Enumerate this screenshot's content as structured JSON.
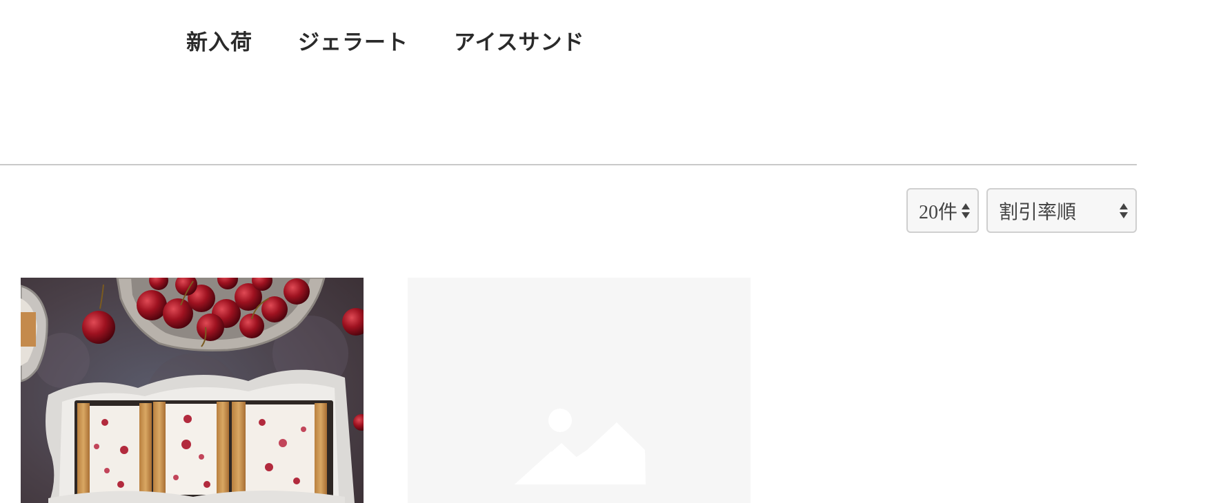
{
  "nav": {
    "items": [
      {
        "label": "新入荷"
      },
      {
        "label": "ジェラート"
      },
      {
        "label": "アイスサンド"
      }
    ]
  },
  "toolbar": {
    "per_page": {
      "selected": "20件"
    },
    "sort": {
      "selected": "割引率順"
    }
  },
  "products": [
    {
      "image": "ice-cream-sandwich-cherries-photo"
    },
    {
      "image": "no-image-placeholder"
    }
  ],
  "colors": {
    "text": "#2a2a2a",
    "divider": "#c9c9c9",
    "placeholder_bg": "#f6f6f6",
    "placeholder_icon": "#ffffff"
  }
}
